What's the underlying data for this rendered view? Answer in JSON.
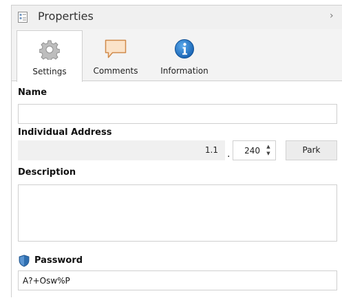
{
  "panel": {
    "title": "Properties",
    "collapse_chevron": "›"
  },
  "tabs": [
    {
      "label": "Settings",
      "icon": "gear-icon",
      "active": true
    },
    {
      "label": "Comments",
      "icon": "speech-bubble-icon",
      "active": false
    },
    {
      "label": "Information",
      "icon": "info-icon",
      "active": false
    }
  ],
  "form": {
    "name": {
      "label": "Name",
      "value": ""
    },
    "individual_address": {
      "label": "Individual Address",
      "prefix": "1.1",
      "separator": ".",
      "device_number": "240",
      "park_label": "Park"
    },
    "description": {
      "label": "Description",
      "value": ""
    },
    "password": {
      "label": "Password",
      "value": "A?+Osw%P"
    }
  },
  "colors": {
    "info_blue": "#1a73c4",
    "shield_blue": "#2f6fb0",
    "comment_fill": "#fbe3c9",
    "comment_stroke": "#d08a4a"
  }
}
